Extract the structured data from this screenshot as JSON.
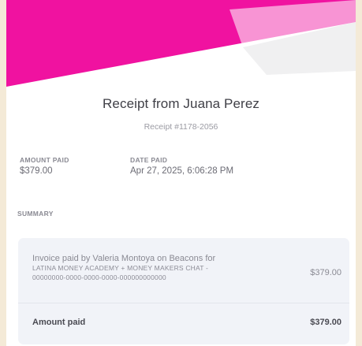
{
  "colors": {
    "page_bg": "#f4ead7",
    "brand_pink": "#f012a0",
    "summary_box": "#f1f3f8"
  },
  "receipt": {
    "title": "Receipt from Juana Perez",
    "number": "Receipt #1178-2056"
  },
  "details": {
    "amount_label": "AMOUNT PAID",
    "amount_value": "$379.00",
    "date_label": "DATE PAID",
    "date_value": "Apr 27, 2025, 6:06:28 PM"
  },
  "summary": {
    "label": "SUMMARY",
    "line_item": {
      "desc_line1": "Invoice paid by Valeria Montoya on Beacons for",
      "desc_line2": "LATINA MONEY ACADEMY + MONEY MAKERS CHAT -",
      "desc_line3": "00000000-0000-0000-0000-000000000000",
      "amount": "$379.00"
    },
    "total_label": "Amount paid",
    "total_amount": "$379.00"
  }
}
